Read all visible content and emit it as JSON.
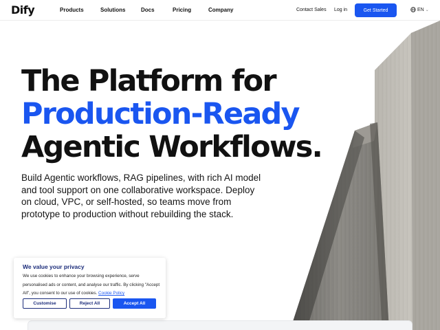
{
  "brand": {
    "logo_text": "Dify",
    "accent_color": "#1a56f0",
    "cookie_title_color": "#1b2c7a"
  },
  "nav": {
    "links": [
      "Products",
      "Solutions",
      "Docs",
      "Pricing",
      "Company"
    ],
    "contact_sales": "Contact Sales",
    "login": "Log in",
    "cta": "Get Started",
    "language": "EN",
    "language_icon": "globe-icon",
    "language_chevron_icon": "chevron-down-icon"
  },
  "hero": {
    "title_line1": "The Platform for",
    "title_line2": "Production-Ready",
    "title_line3": "Agentic Workflows.",
    "description": "Build Agentic workflows, RAG pipelines, with rich AI model and tool support on one collaborative workspace. Deploy on cloud, VPC, or self-hosted, so teams move from prototype to production without rebuilding the stack.",
    "image": "concrete-pillars-photo"
  },
  "cookie": {
    "title": "We value your privacy",
    "text": "We use cookies to enhance your browsing experience, serve personalised ads or content, and analyse our traffic. By clicking \"Accept All\", you consent to our use of cookies.",
    "policy_link": "Cookie Policy",
    "buttons": {
      "customise": "Customise",
      "reject": "Reject All",
      "accept": "Accept All"
    }
  }
}
